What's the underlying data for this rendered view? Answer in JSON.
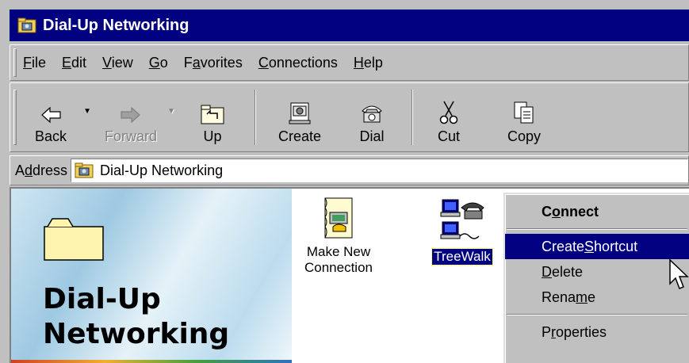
{
  "window": {
    "title": "Dial-Up Networking"
  },
  "menubar": {
    "items": [
      {
        "ul": "F",
        "rest": "ile"
      },
      {
        "ul": "E",
        "rest": "dit"
      },
      {
        "ul": "V",
        "rest": "iew"
      },
      {
        "ul": "G",
        "rest": "o"
      },
      {
        "pre": "F",
        "ul": "a",
        "rest": "vorites"
      },
      {
        "ul": "C",
        "rest": "onnections"
      },
      {
        "ul": "H",
        "rest": "elp"
      }
    ]
  },
  "toolbar": {
    "back": "Back",
    "forward": "Forward",
    "up": "Up",
    "create": "Create",
    "dial": "Dial",
    "cut": "Cut",
    "copy": "Copy"
  },
  "address": {
    "label_pre": "A",
    "label_ul": "d",
    "label_rest": "dress",
    "value": "Dial-Up Networking"
  },
  "content": {
    "panel_title_line1": "Dial-Up",
    "panel_title_line2": "Networking",
    "icons": {
      "make_new_line1": "Make New",
      "make_new_line2": "Connection",
      "treewalk": "TreeWalk"
    }
  },
  "context_menu": {
    "connect": {
      "pre": "C",
      "ul": "o",
      "rest": "nnect"
    },
    "create_shortcut": {
      "pre": "Create ",
      "ul": "S",
      "rest": "hortcut"
    },
    "delete": {
      "pre": "",
      "ul": "D",
      "rest": "elete"
    },
    "rename": {
      "pre": "Rena",
      "ul": "m",
      "rest": "e"
    },
    "properties": {
      "pre": "P",
      "ul": "r",
      "rest": "operties"
    }
  },
  "colors": {
    "titlebar": "#000080",
    "window_face": "#c0c0c0",
    "highlight": "#000080"
  }
}
